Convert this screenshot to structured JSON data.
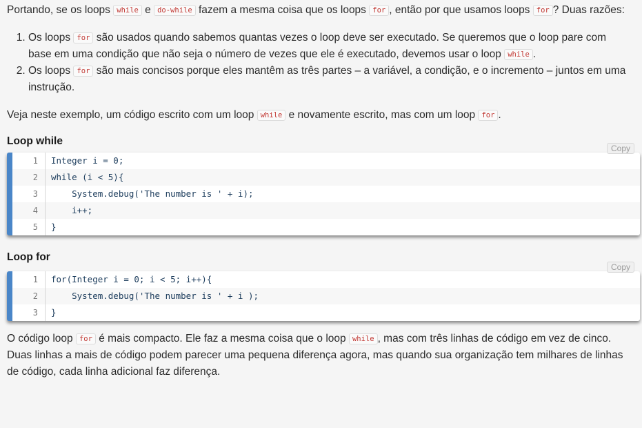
{
  "intro": {
    "t1": "Portando, se os loops ",
    "c1": "while",
    "t2": " e ",
    "c2": "do-while",
    "t3": " fazem a mesma coisa que os loops ",
    "c3": "for",
    "t4": ", então por que usamos loops ",
    "c4": "for",
    "t5": "? Duas razões:"
  },
  "reasons": [
    {
      "t1": "Os loops ",
      "c1": "for",
      "t2": " são usados quando sabemos quantas vezes o loop deve ser executado. Se queremos que o loop pare com base em uma condição que não seja o número de vezes que ele é executado, devemos usar o loop ",
      "c2": "while",
      "t3": "."
    },
    {
      "t1": "Os loops ",
      "c1": "for",
      "t2": " são mais concisos porque eles mantêm as três partes – a variável, a condição, e o incremento – juntos em uma instrução."
    }
  ],
  "example": {
    "t1": "Veja neste exemplo, um código escrito com um loop ",
    "c1": "while",
    "t2": " e novamente escrito, mas com um loop ",
    "c2": "for",
    "t3": "."
  },
  "while_block": {
    "heading": "Loop while",
    "copy_label": "Copy",
    "lines": [
      {
        "n": "1",
        "code": "Integer i = 0;"
      },
      {
        "n": "2",
        "code": "while (i < 5){"
      },
      {
        "n": "3",
        "code": "    System.debug('The number is ' + i);"
      },
      {
        "n": "4",
        "code": "    i++;"
      },
      {
        "n": "5",
        "code": "}"
      }
    ]
  },
  "for_block": {
    "heading": "Loop for",
    "copy_label": "Copy",
    "lines": [
      {
        "n": "1",
        "code": "for(Integer i = 0; i < 5; i++){"
      },
      {
        "n": "2",
        "code": "    System.debug('The number is ' + i );"
      },
      {
        "n": "3",
        "code": "}"
      }
    ]
  },
  "conclusion": {
    "t1": "O código loop ",
    "c1": "for",
    "t2": " é mais compacto. Ele faz a mesma coisa que o loop ",
    "c2": "while",
    "t3": ", mas com três linhas de código em vez de cinco. Duas linhas a mais de código podem parecer uma pequena diferença agora, mas quando sua organização tem milhares de linhas de código, cada linha adicional faz diferença."
  },
  "colors": {
    "accent_bar": "#4a86c8",
    "inline_code": "#c23934"
  }
}
